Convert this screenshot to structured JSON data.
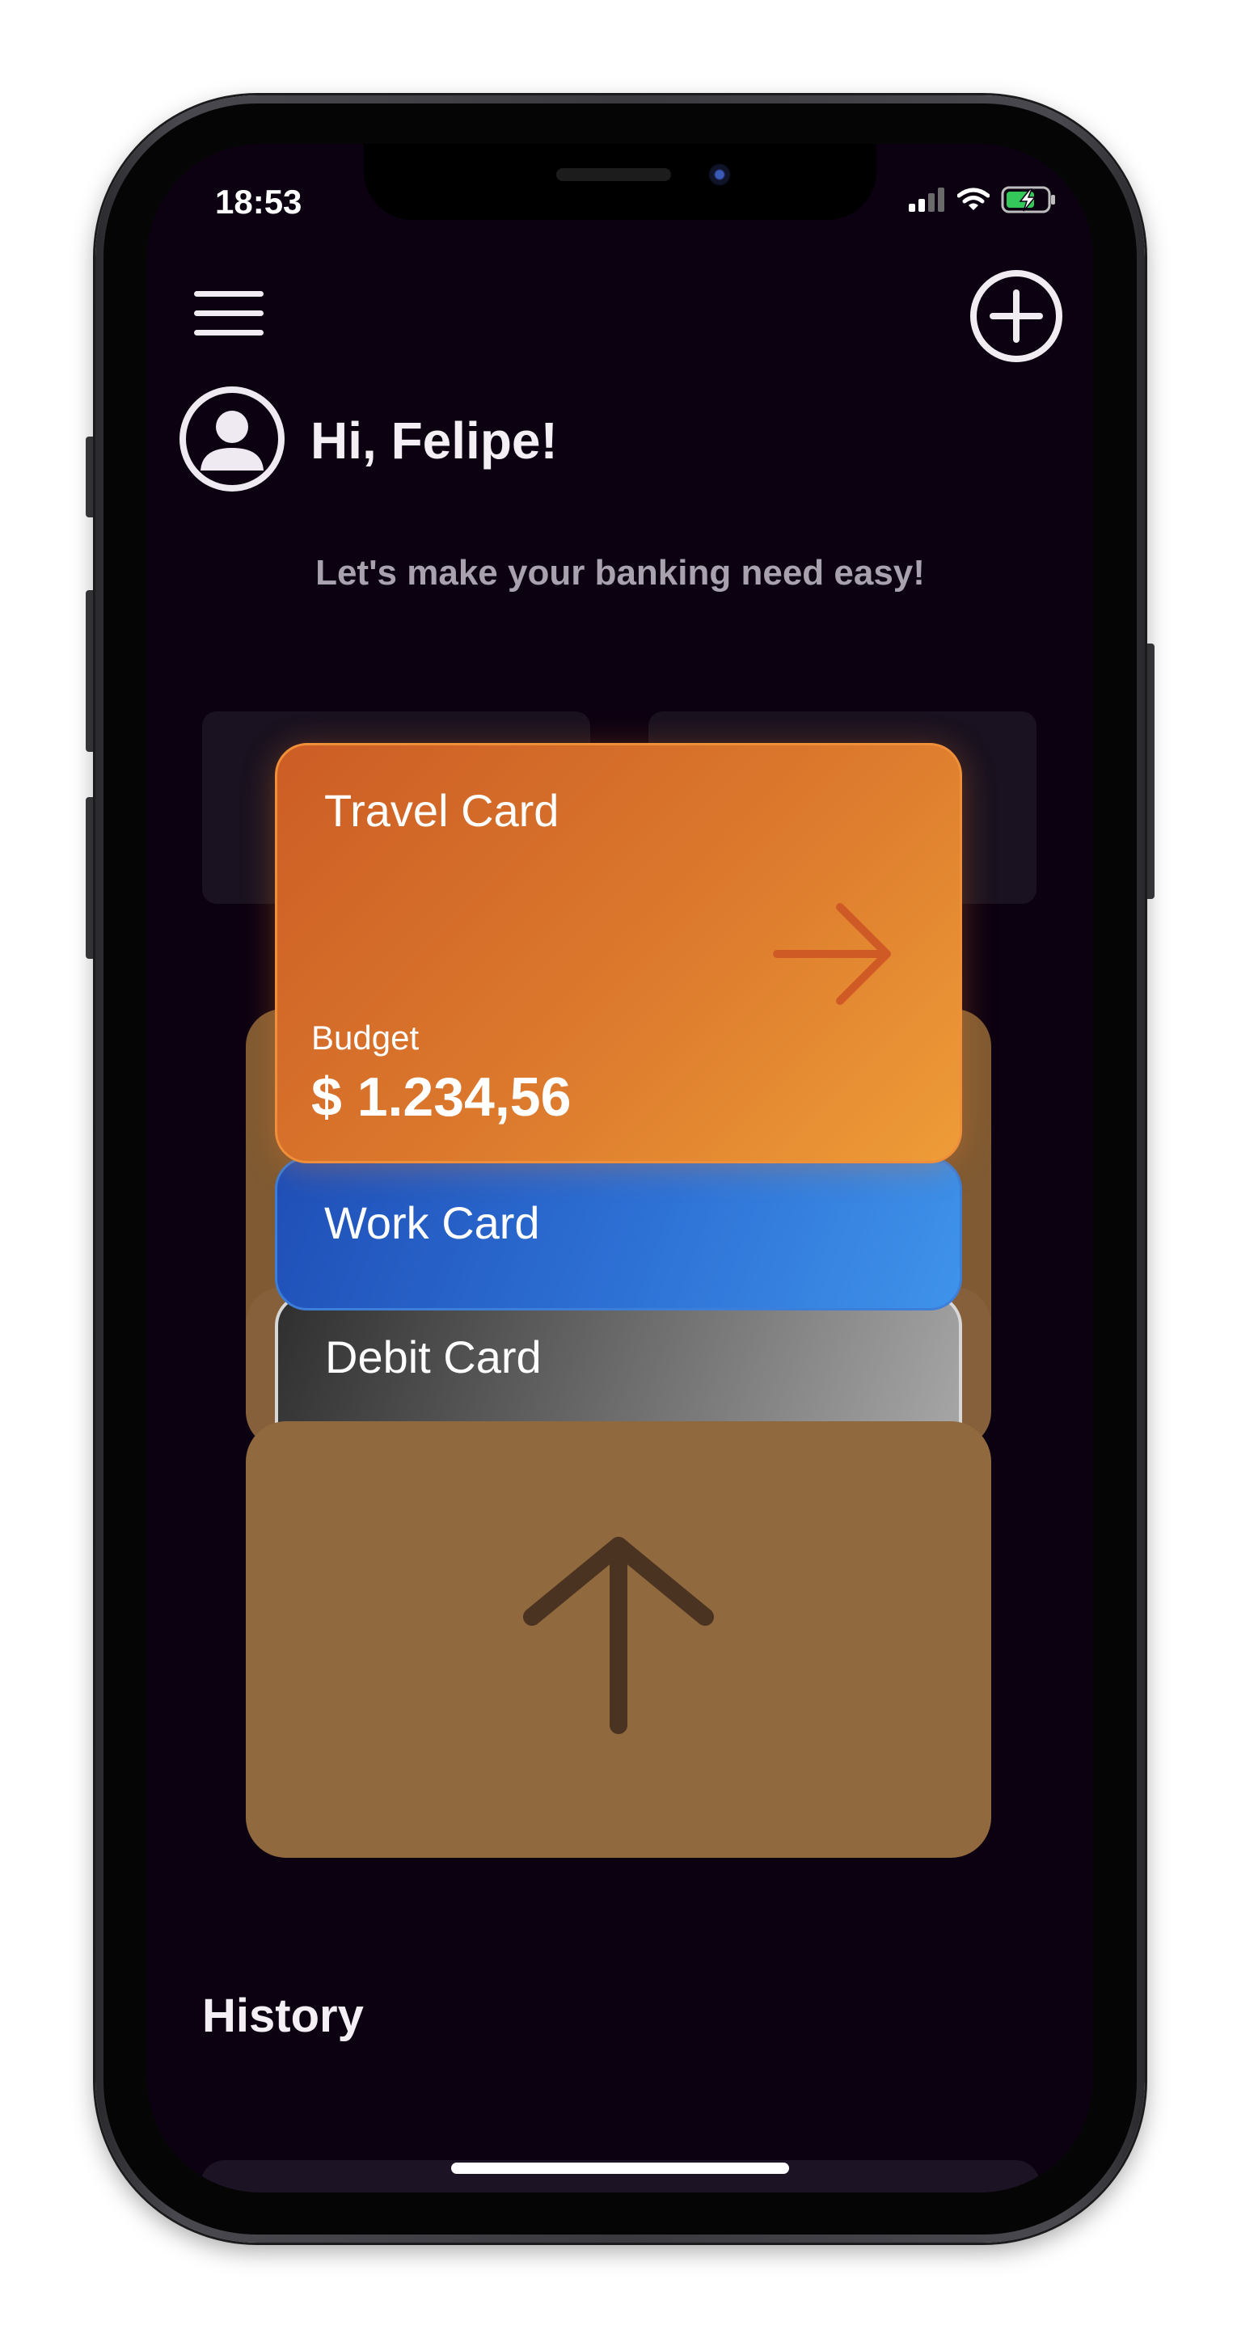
{
  "status_bar": {
    "time": "18:53",
    "icons": [
      "signal-icon",
      "wifi-icon",
      "battery-charging-icon"
    ]
  },
  "header": {
    "menu_icon": "hamburger-menu-icon",
    "add_icon": "plus-circle-icon",
    "avatar_icon": "user-avatar-icon",
    "greeting": "Hi, Felipe!",
    "subtitle": "Let's make your banking need easy!"
  },
  "cards": {
    "travel": {
      "title": "Travel Card",
      "budget_label": "Budget",
      "budget_value": "$ 1.234,56",
      "color": "#dc7a2d",
      "arrow_icon": "arrow-right-icon"
    },
    "work": {
      "title": "Work Card",
      "color": "#2e72d6"
    },
    "debit": {
      "title": "Debit Card",
      "color": "#6b6b6b"
    }
  },
  "wallet": {
    "color": "#91693e",
    "icon": "arrow-up-icon"
  },
  "history": {
    "title": "History"
  },
  "colors": {
    "background": "#0c0111",
    "text": "#f3eff5",
    "muted_text": "#a8a1ae"
  }
}
